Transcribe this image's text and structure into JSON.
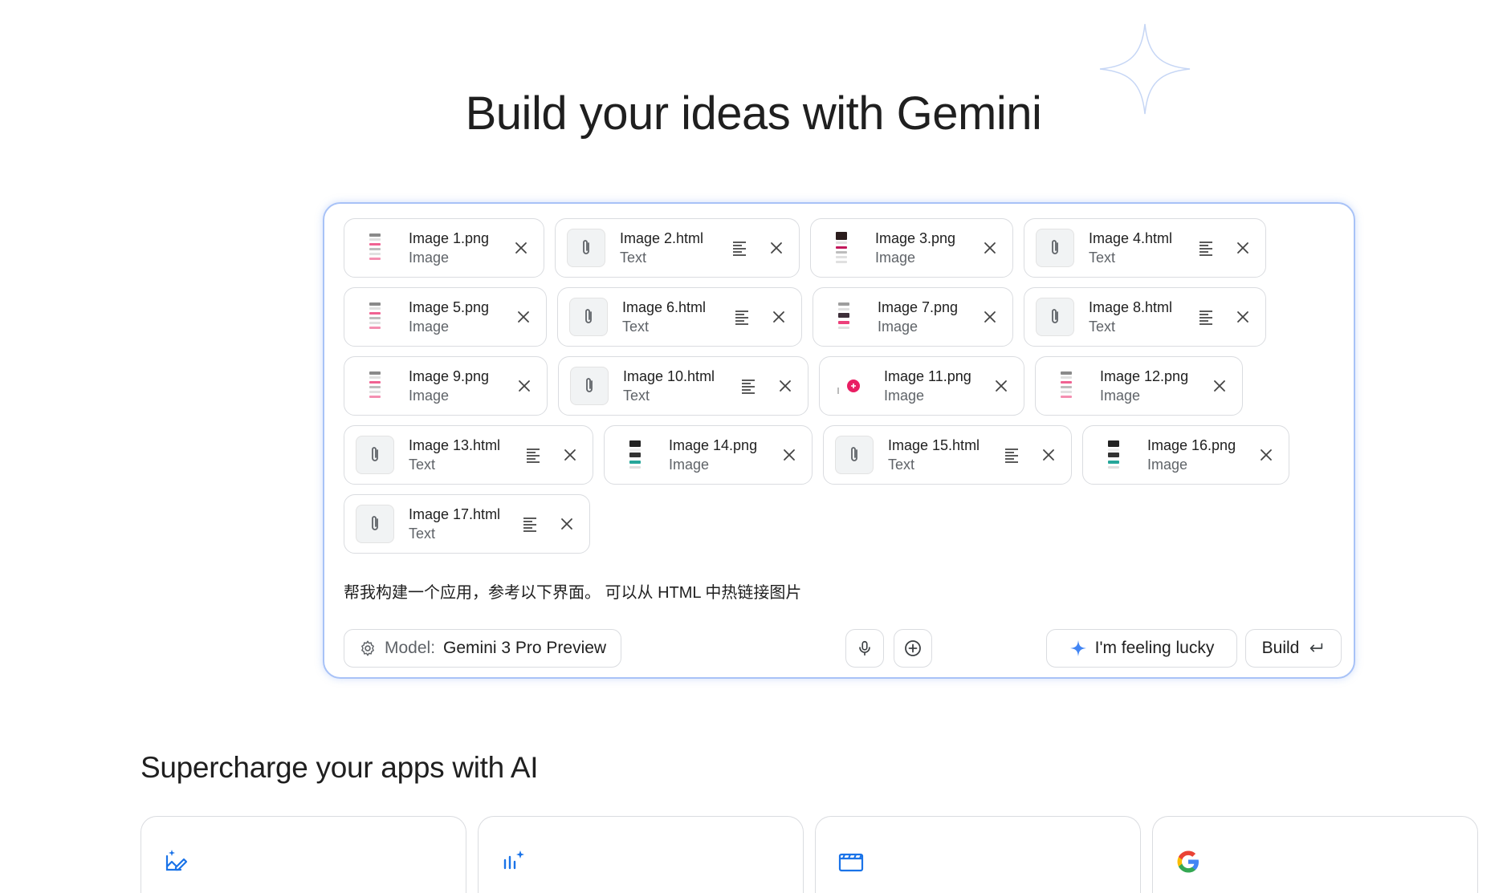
{
  "hero": {
    "title": "Build your ideas with Gemini"
  },
  "attachments": {
    "rows": [
      [
        {
          "name": "Image 1.png",
          "kind": "Image",
          "type": "image",
          "width": 250,
          "thumb": "pink"
        },
        {
          "name": "Image 2.html",
          "kind": "Text",
          "type": "file",
          "width": 305
        },
        {
          "name": "Image 3.png",
          "kind": "Image",
          "type": "image",
          "width": 253,
          "thumb": "dark"
        },
        {
          "name": "Image 4.html",
          "kind": "Text",
          "type": "file",
          "width": 302
        }
      ],
      [
        {
          "name": "Image 5.png",
          "kind": "Image",
          "type": "image",
          "width": 253,
          "thumb": "pink"
        },
        {
          "name": "Image 6.html",
          "kind": "Text",
          "type": "file",
          "width": 305
        },
        {
          "name": "Image 7.png",
          "kind": "Image",
          "type": "image",
          "width": 250,
          "thumb": "magenta"
        },
        {
          "name": "Image 8.html",
          "kind": "Text",
          "type": "file",
          "width": 302
        }
      ],
      [
        {
          "name": "Image 9.png",
          "kind": "Image",
          "type": "image",
          "width": 254,
          "thumb": "pink"
        },
        {
          "name": "Image 10.html",
          "kind": "Text",
          "type": "file",
          "width": 312
        },
        {
          "name": "Image 11.png",
          "kind": "Image",
          "type": "image",
          "width": 256,
          "thumb": "dot"
        },
        {
          "name": "Image 12.png",
          "kind": "Image",
          "type": "image",
          "width": 259,
          "thumb": "pink"
        }
      ],
      [
        {
          "name": "Image 13.html",
          "kind": "Text",
          "type": "file",
          "width": 311
        },
        {
          "name": "Image 14.png",
          "kind": "Image",
          "type": "image",
          "width": 260,
          "thumb": "green"
        },
        {
          "name": "Image 15.html",
          "kind": "Text",
          "type": "file",
          "width": 310
        },
        {
          "name": "Image 16.png",
          "kind": "Image",
          "type": "image",
          "width": 258,
          "thumb": "green"
        }
      ],
      [
        {
          "name": "Image 17.html",
          "kind": "Text",
          "type": "file",
          "width": 307
        }
      ]
    ]
  },
  "prompt": {
    "text": "帮我构建一个应用，参考以下界面。 可以从 HTML 中热链接图片"
  },
  "toolbar": {
    "model_label": "Model:",
    "model_value": "Gemini 3 Pro Preview",
    "lucky_label": "I'm feeling lucky",
    "build_label": "Build"
  },
  "section": {
    "title": "Supercharge your apps with AI"
  },
  "cards": [
    {
      "icon": "image-edit-icon"
    },
    {
      "icon": "audio-spark-icon"
    },
    {
      "icon": "clapperboard-icon"
    },
    {
      "icon": "google-g-icon"
    }
  ],
  "colors": {
    "accent": "#4285f4",
    "border": "#dadce0",
    "focus": "#a8c2f7"
  }
}
